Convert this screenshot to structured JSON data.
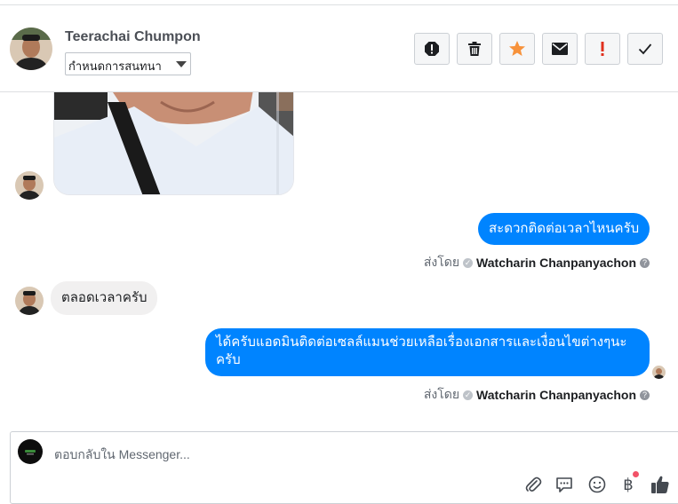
{
  "header": {
    "contact_name": "Teerachai Chumpon",
    "assign_select": "กำหนดการสนทนา",
    "toolbar": [
      {
        "name": "report-spam-icon"
      },
      {
        "name": "trash-icon"
      },
      {
        "name": "star-icon",
        "color": "#f7923b"
      },
      {
        "name": "envelope-icon"
      },
      {
        "name": "exclamation-icon",
        "color": "#e0301e"
      },
      {
        "name": "checkmark-icon"
      }
    ]
  },
  "messages": [
    {
      "type": "incoming-photo"
    },
    {
      "type": "outgoing",
      "text": "สะดวกติดต่อเวลาไหนครับ",
      "sent_by_label": "ส่งโดย",
      "sender": "Watcharin Chanpanyachon"
    },
    {
      "type": "incoming",
      "text": "ตลอดเวลาครับ"
    },
    {
      "type": "outgoing",
      "text": "ได้ครับแอดมินติดต่อเซลล์แมนช่วยเหลือเรื่องเอกสารและเงื่อนไขต่างๆนะครับ",
      "sent_by_label": "ส่งโดย",
      "sender": "Watcharin Chanpanyachon"
    }
  ],
  "composer": {
    "placeholder": "ตอบกลับใน Messenger...",
    "icons": [
      "paperclip-icon",
      "quick-reply-icon",
      "emoji-icon",
      "baht-payment-icon",
      "thumbs-up-icon"
    ],
    "colors": {
      "accent": "#0084ff",
      "notification": "#f25268"
    }
  }
}
